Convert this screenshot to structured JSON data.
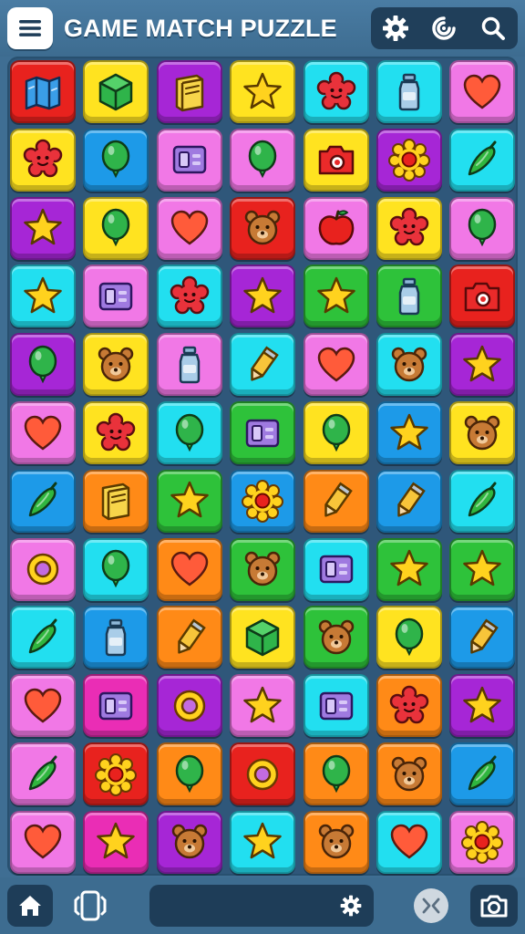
{
  "header": {
    "title": "GAME MATCH PUZZLE",
    "icons": [
      "menu-icon",
      "gear-icon",
      "swirl-icon",
      "search-icon"
    ]
  },
  "board": {
    "columns": 7,
    "rows": 12,
    "colors": {
      "red": "#e8221e",
      "yellow": "#ffe320",
      "purple": "#a626d6",
      "cyan": "#22dff0",
      "pink": "#f178e6",
      "blue": "#1d9ae8",
      "green": "#2ec23a",
      "orange": "#ff8a17",
      "magenta": "#ea2db5"
    },
    "tiles": [
      [
        "red:map",
        "yellow:cube",
        "purple:book",
        "yellow:star",
        "cyan:flower-face",
        "cyan:bottle",
        "pink:heart"
      ],
      [
        "yellow:flower-face",
        "blue:balloon",
        "pink:device",
        "pink:balloon",
        "yellow:camera",
        "purple:sunflower",
        "cyan:pepper"
      ],
      [
        "purple:star",
        "yellow:balloon",
        "pink:heart",
        "red:bear",
        "pink:apple",
        "yellow:flower-face",
        "pink:balloon"
      ],
      [
        "cyan:star",
        "pink:device",
        "cyan:flower-face",
        "purple:star",
        "green:star",
        "green:bottle",
        "red:camera"
      ],
      [
        "purple:balloon",
        "yellow:bear",
        "pink:bottle",
        "cyan:pencil",
        "pink:heart",
        "cyan:bear",
        "purple:star"
      ],
      [
        "pink:heart",
        "yellow:flower-face",
        "cyan:balloon",
        "green:device",
        "yellow:balloon",
        "blue:star",
        "yellow:bear"
      ],
      [
        "blue:pepper",
        "orange:book",
        "green:star",
        "blue:sunflower",
        "orange:pencil",
        "blue:pencil",
        "cyan:pepper"
      ],
      [
        "pink:ring",
        "cyan:balloon",
        "orange:heart",
        "green:bear",
        "cyan:device",
        "green:star",
        "green:star"
      ],
      [
        "cyan:pepper",
        "blue:bottle",
        "orange:pencil",
        "yellow:cube",
        "green:bear",
        "yellow:balloon",
        "blue:pencil"
      ],
      [
        "pink:heart",
        "magenta:device",
        "purple:ring",
        "pink:star",
        "cyan:device",
        "orange:flower-face",
        "purple:star"
      ],
      [
        "pink:pepper",
        "red:sunflower",
        "orange:balloon",
        "red:ring",
        "orange:balloon",
        "orange:bear",
        "blue:pepper"
      ],
      [
        "pink:heart",
        "magenta:star",
        "purple:bear",
        "cyan:star",
        "orange:bear",
        "cyan:heart",
        "pink:sunflower"
      ]
    ]
  },
  "footer": {
    "icons": [
      "home-icon",
      "device-icon",
      "gear-icon",
      "swap-icon",
      "camera-icon"
    ]
  }
}
